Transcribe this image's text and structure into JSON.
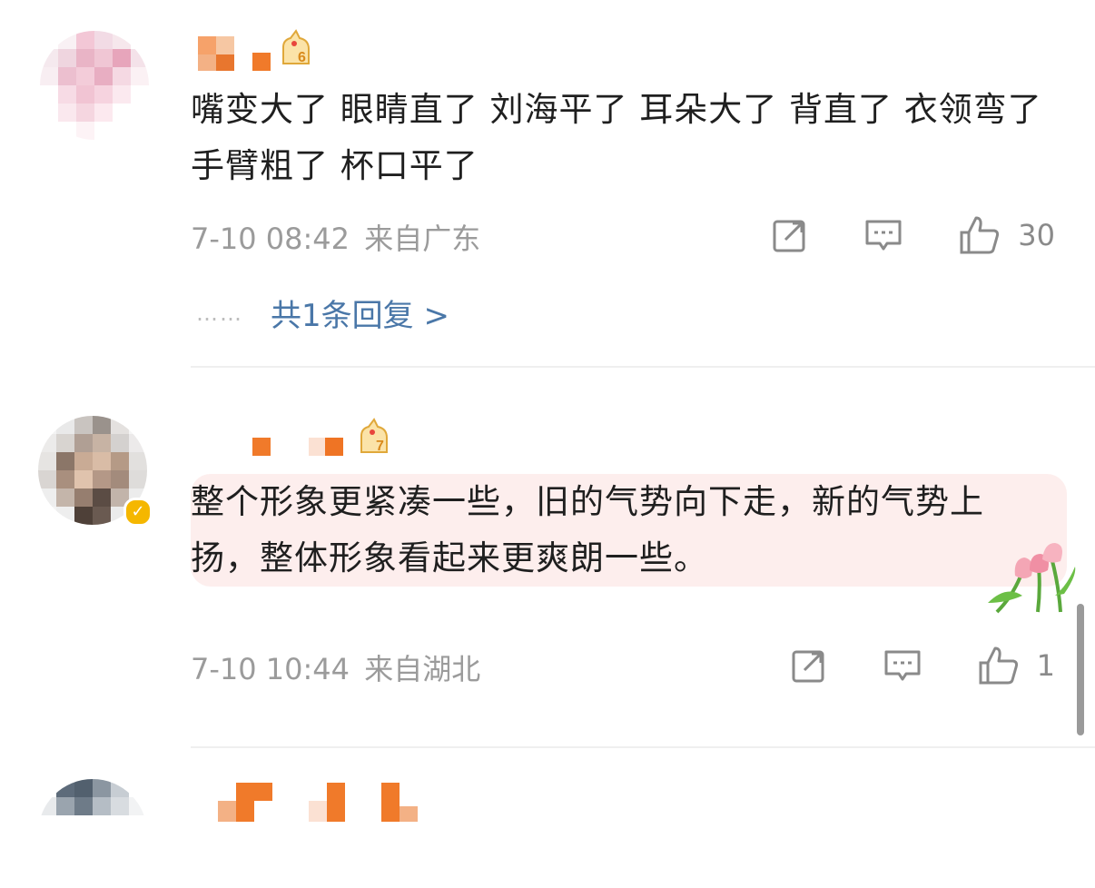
{
  "comments": [
    {
      "text": "嘴变大了 眼睛直了 刘海平了 耳朵大了 背直了 衣领弯了 手臂粗了 杯口平了",
      "level": "6",
      "time": "7-10 08:42",
      "location": "来自广东",
      "likes": "30",
      "replies_label": "共1条回复 >",
      "replies_dots": "……"
    },
    {
      "text": "整个形象更紧凑一些，旧的气势向下走，新的气势上扬，整体形象看起来更爽朗一些。",
      "level": "7",
      "time": "7-10 10:44",
      "location": "来自湖北",
      "likes": "1",
      "verified": "✓"
    }
  ],
  "icons": {
    "share": "share-icon",
    "comment": "comment-icon",
    "like": "like-icon",
    "level": "level-badge-icon",
    "decor": "tulip-sticker"
  },
  "colors": {
    "link": "#4a77a8",
    "meta": "#9b9b9b",
    "highlight": "#fdeeed",
    "name_orange": "#f07a2a",
    "verified": "#f5b700"
  }
}
